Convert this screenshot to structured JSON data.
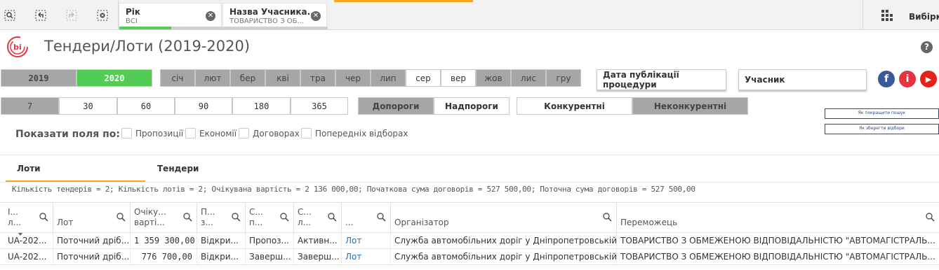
{
  "selections": [
    {
      "field": "Рік",
      "value": "ВСІ",
      "bar_color": "#52cc52"
    },
    {
      "field": "Назва Учасника...",
      "value": "ТОВАРИСТВО З ОБ...",
      "bar_color": "#d0d0d0"
    }
  ],
  "selections_label": "Вибірки",
  "header": {
    "title": "Тендери/Лоти (2019-2020)",
    "help": "?"
  },
  "years": [
    "2019",
    "2020"
  ],
  "months": [
    "січ",
    "лют",
    "бер",
    "кві",
    "тра",
    "чер",
    "лип",
    "сер",
    "вер",
    "жов",
    "лис",
    "гру"
  ],
  "days": [
    "7",
    "30",
    "60",
    "90",
    "180",
    "365"
  ],
  "thresholds": [
    "Допороги",
    "Надпороги"
  ],
  "competition": [
    "Конкурентні",
    "Неконкурентні"
  ],
  "dropdowns": {
    "pub_date": "Дата публікації процедури",
    "participant": "Учасник"
  },
  "social": {
    "facebook": "f",
    "info": "i",
    "youtube": "▶"
  },
  "links": {
    "improve_search": "Як покращити пошук",
    "save_selections": "Як зберегти відбори"
  },
  "show_fields": {
    "label": "Показати поля по:",
    "options": [
      "Пропозиції",
      "Економії",
      "Договорах",
      "Попередніх відборах"
    ]
  },
  "tabs": [
    "Лоти",
    "Тендери"
  ],
  "summary": "Кількість тендерів = 2; Кількість лотів = 2; Очікувана вартість = 2 136 000,00; Початкова сума договорів = 527 500,00; Поточна сума договорів = 527 500,00",
  "table": {
    "columns": [
      {
        "l1": "І...",
        "l2": "л..."
      },
      {
        "l1": "",
        "l2": "Лот"
      },
      {
        "l1": "Очіку...",
        "l2": "варті..."
      },
      {
        "l1": "П...",
        "l2": "з..."
      },
      {
        "l1": "С...",
        "l2": "п..."
      },
      {
        "l1": "С...",
        "l2": "л..."
      },
      {
        "l1": "",
        "l2": "..."
      },
      {
        "l1": "",
        "l2": "Організатор"
      },
      {
        "l1": "",
        "l2": "Переможець"
      }
    ],
    "rows": [
      [
        "UA-202...",
        "Поточний дріб...",
        "1 359 300,00",
        "Відкри...",
        "Пропоз...",
        "Активн...",
        "Лот",
        "Служба автомобільних доріг у Дніпропетровській ...",
        "ТОВАРИСТВО З ОБМЕЖЕНОЮ ВІДПОВІДАЛЬНІСТЮ \"АВТОМАГІСТРАЛЬ..."
      ],
      [
        "UA-202...",
        "Поточний дріб...",
        "776 700,00",
        "Відкри...",
        "Заверш...",
        "Заверш...",
        "Лот",
        "Служба автомобільних доріг у Дніпропетровській ...",
        "ТОВАРИСТВО З ОБМЕЖЕНОЮ ВІДПОВІДАЛЬНІСТЮ \"АВТОМАГІСТРАЛЬ..."
      ]
    ]
  },
  "colors": {
    "selected": "#52cc52",
    "excluded": "#a6a6a6",
    "accent": "#f6a623",
    "link": "#2b70b8"
  }
}
